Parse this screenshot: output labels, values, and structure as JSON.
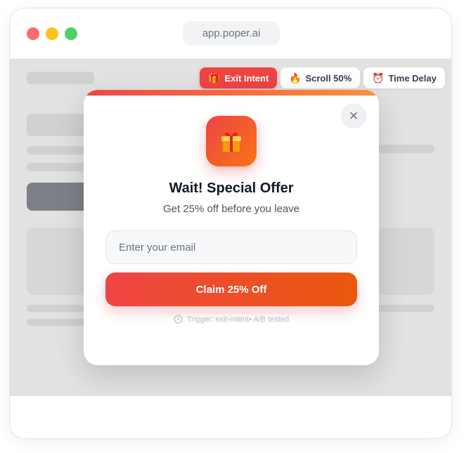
{
  "browser": {
    "url": "app.poper.ai"
  },
  "triggers": [
    {
      "label": "Exit Intent",
      "icon": "gift-icon",
      "active": true
    },
    {
      "label": "Scroll 50%",
      "icon": "fire-icon",
      "active": false
    },
    {
      "label": "Time Delay",
      "icon": "alarm-clock-icon",
      "active": false
    }
  ],
  "popup": {
    "title": "Wait! Special Offer",
    "subtitle": "Get 25% off before you leave",
    "email_placeholder": "Enter your email",
    "cta_label": "Claim 25% Off",
    "trigger_note": "Trigger: exit-intent• A/B tested",
    "close_label": "×"
  },
  "colors": {
    "accent": "#ef4444",
    "accent_orange": "#f97316"
  }
}
